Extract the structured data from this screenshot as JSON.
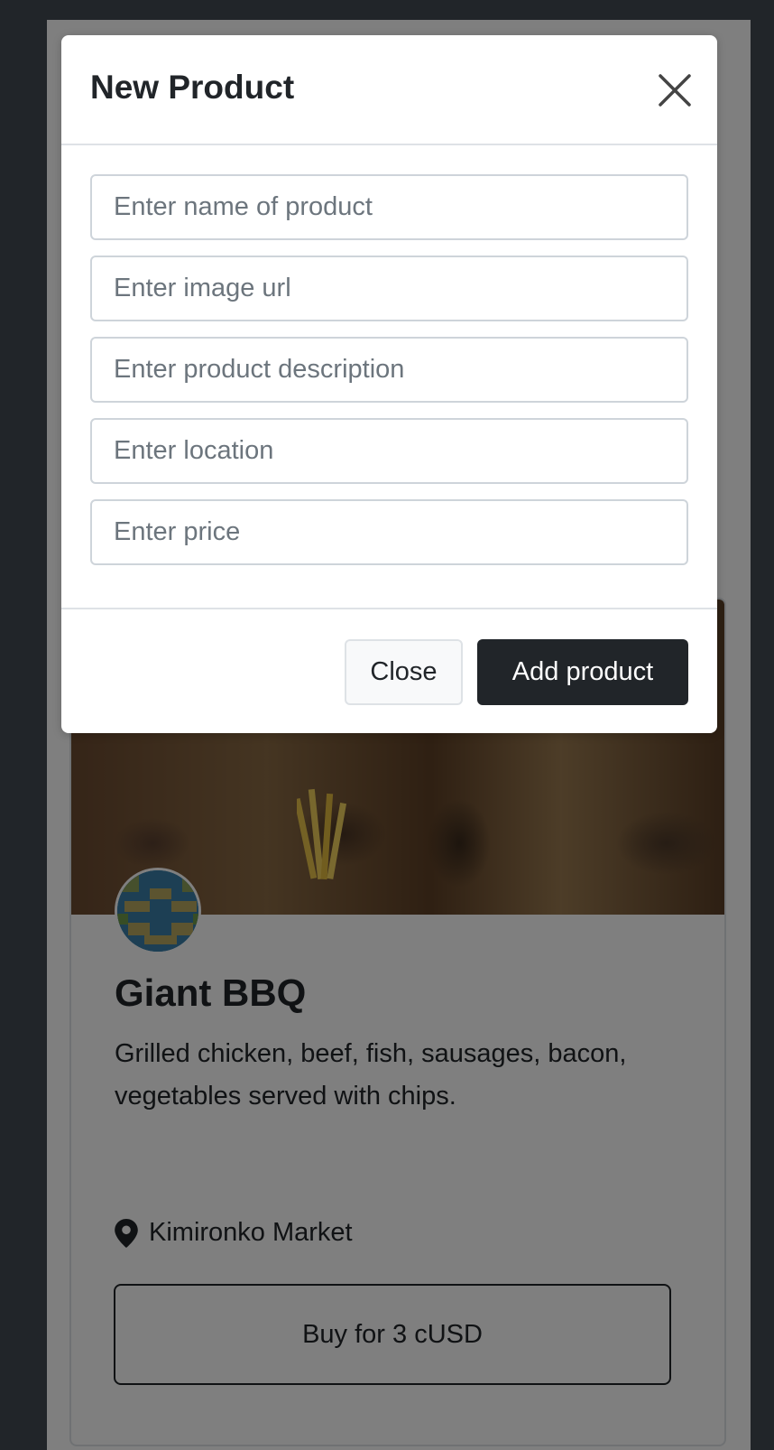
{
  "modal": {
    "title": "New Product",
    "fields": {
      "name_placeholder": "Enter name of product",
      "image_placeholder": "Enter image url",
      "description_placeholder": "Enter product description",
      "location_placeholder": "Enter location",
      "price_placeholder": "Enter price"
    },
    "close_label": "Close",
    "add_label": "Add product"
  },
  "card": {
    "title": "Giant BBQ",
    "description": "Grilled chicken, beef, fish, sausages, bacon, vegetables served with chips.",
    "location": "Kimironko Market",
    "buy_label": "Buy for 3 cUSD"
  },
  "colors": {
    "primary_dark": "#212529",
    "border": "#dee2e6",
    "placeholder": "#6c757d"
  },
  "icons": {
    "close": "close-icon",
    "location": "map-pin-icon"
  }
}
